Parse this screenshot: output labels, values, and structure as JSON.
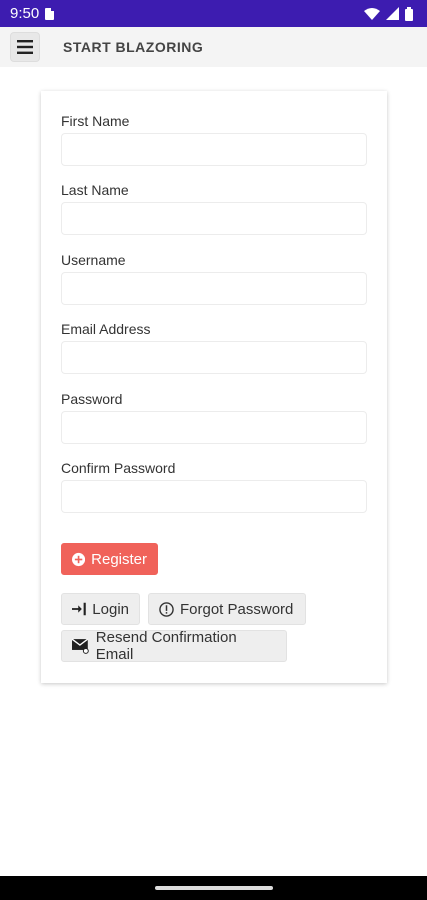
{
  "status_bar": {
    "time": "9:50",
    "bg_color": "#3d1cb0",
    "icons": [
      "sim-icon",
      "wifi-icon",
      "signal-icon",
      "battery-icon"
    ]
  },
  "app_bar": {
    "menu_icon": "hamburger-menu-icon",
    "title": "START BLAZORING"
  },
  "form": {
    "fields": [
      {
        "label": "First Name",
        "value": "",
        "placeholder": ""
      },
      {
        "label": "Last Name",
        "value": "",
        "placeholder": ""
      },
      {
        "label": "Username",
        "value": "",
        "placeholder": ""
      },
      {
        "label": "Email Address",
        "value": "",
        "placeholder": ""
      },
      {
        "label": "Password",
        "value": "",
        "placeholder": ""
      },
      {
        "label": "Confirm Password",
        "value": "",
        "placeholder": ""
      }
    ],
    "register_label": "Register",
    "register_color": "#f0625a",
    "login_label": "Login",
    "forgot_label": "Forgot Password",
    "resend_label": "Resend Confirmation Email"
  }
}
